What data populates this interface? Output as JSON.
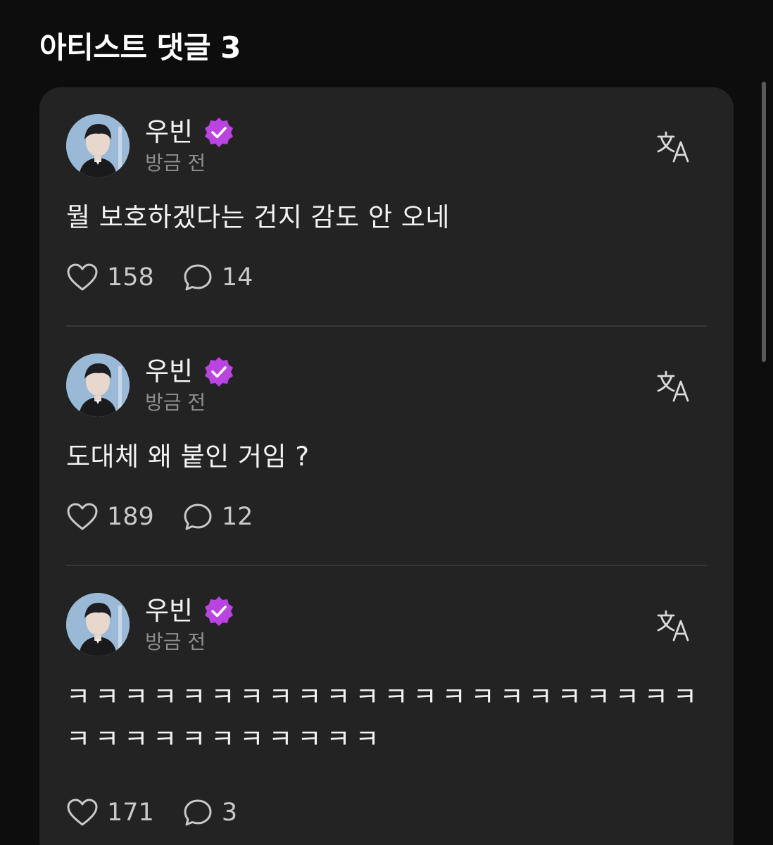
{
  "section": {
    "title": "아티스트 댓글 3"
  },
  "colors": {
    "background": "#0d0d0d",
    "card": "#232323",
    "badge": "#b944e0",
    "muted": "#8d8d8d"
  },
  "comments": [
    {
      "author": "우빈",
      "verified": true,
      "time": "방금 전",
      "text": "뭘 보호하겠다는 건지 감도 안 오네",
      "likes": "158",
      "replies": "14",
      "icons": {
        "like": "heart-icon",
        "reply": "speech-bubble-icon",
        "translate": "translate-icon"
      }
    },
    {
      "author": "우빈",
      "verified": true,
      "time": "방금 전",
      "text": "도대체 왜 붙인 거임 ?",
      "likes": "189",
      "replies": "12",
      "icons": {
        "like": "heart-icon",
        "reply": "speech-bubble-icon",
        "translate": "translate-icon"
      }
    },
    {
      "author": "우빈",
      "verified": true,
      "time": "방금 전",
      "text": "ㅋㅋㅋㅋㅋㅋㅋㅋㅋㅋㅋㅋㅋㅋㅋㅋㅋㅋㅋㅋㅋㅋㅋㅋㅋㅋㅋㅋㅋㅋㅋㅋㅋ",
      "likes": "171",
      "replies": "3",
      "icons": {
        "like": "heart-icon",
        "reply": "speech-bubble-icon",
        "translate": "translate-icon"
      }
    }
  ]
}
